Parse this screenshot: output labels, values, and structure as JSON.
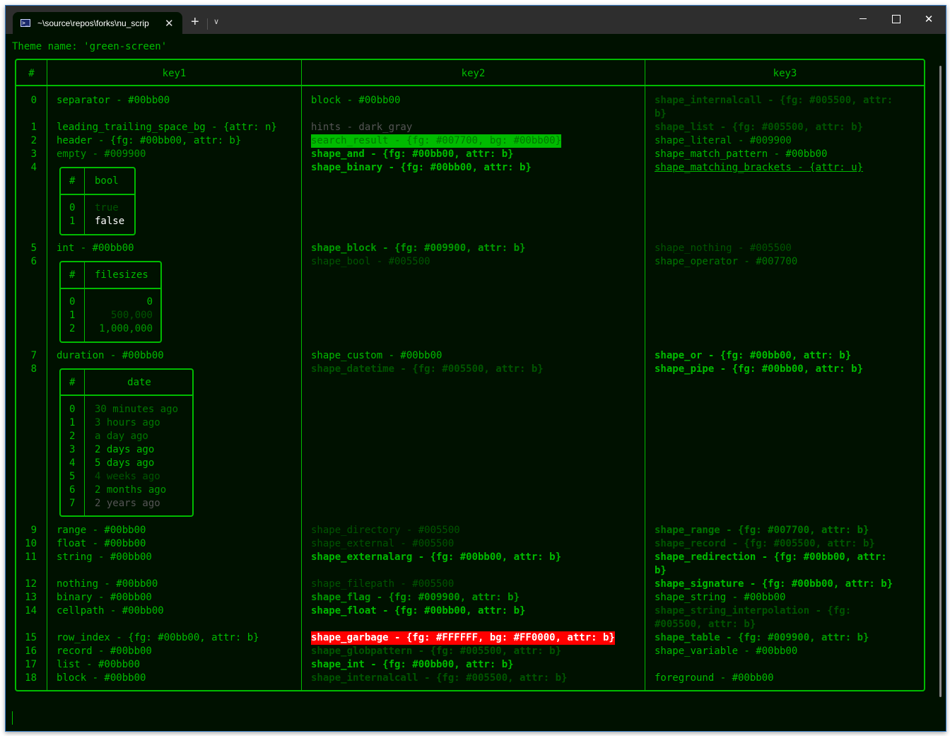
{
  "window": {
    "tab_title": "~\\source\\repos\\forks\\nu_scrip",
    "tab_icon": "powershell-icon",
    "tab_close": "✕",
    "new_tab": "+",
    "dropdown": "⌄",
    "minimize": "minimize",
    "maximize": "maximize",
    "close": "✕"
  },
  "terminal": {
    "theme_line": "Theme name: 'green-screen'",
    "table": {
      "headers": [
        "#",
        "key1",
        "key2",
        "key3"
      ],
      "index": [
        "0",
        "1",
        "2",
        "3",
        "4",
        "5",
        "6",
        "7",
        "8",
        "9",
        "10",
        "11",
        "12",
        "13",
        "14",
        "15",
        "16",
        "17",
        "18"
      ],
      "key1": {
        "separator": "separator - #00bb00",
        "leading_trailing_space_bg": "leading_trailing_space_bg - {attr: n}",
        "header": "header - {fg: #00bb00, attr: b}",
        "empty": "empty - #009900",
        "bool_table": {
          "headers": [
            "#",
            "bool"
          ],
          "rows": [
            {
              "index": "0",
              "value": "true"
            },
            {
              "index": "1",
              "value": "false"
            }
          ]
        },
        "int": "int - #00bb00",
        "filesizes_table": {
          "headers": [
            "#",
            "filesizes"
          ],
          "rows": [
            {
              "index": "0",
              "value": "0"
            },
            {
              "index": "1",
              "value": "500,000"
            },
            {
              "index": "2",
              "value": "1,000,000"
            }
          ]
        },
        "duration": "duration - #00bb00",
        "date_table": {
          "headers": [
            "#",
            "date"
          ],
          "rows": [
            {
              "index": "0",
              "value": "30 minutes ago"
            },
            {
              "index": "1",
              "value": "3 hours ago"
            },
            {
              "index": "2",
              "value": "a day ago"
            },
            {
              "index": "3",
              "value": "2 days ago"
            },
            {
              "index": "4",
              "value": "5 days ago"
            },
            {
              "index": "5",
              "value": "4 weeks ago"
            },
            {
              "index": "6",
              "value": "2 months ago"
            },
            {
              "index": "7",
              "value": "2 years ago"
            }
          ]
        },
        "range": "range - #00bb00",
        "float": "float - #00bb00",
        "string": "string - #00bb00",
        "nothing": "nothing - #00bb00",
        "binary": "binary - #00bb00",
        "cellpath": "cellpath - #00bb00",
        "row_index": "row_index - {fg: #00bb00, attr: b}",
        "record": "record - #00bb00",
        "list": "list - #00bb00",
        "block": "block - #00bb00"
      },
      "key2": {
        "block": "block - #00bb00",
        "hints": "hints - dark_gray",
        "search_result": "search_result - {fg: #007700, bg: #00bb00}",
        "shape_and": "shape_and - {fg: #00bb00, attr: b}",
        "shape_binary": "shape_binary - {fg: #00bb00, attr: b}",
        "shape_block": "shape_block - {fg: #009900, attr: b}",
        "shape_bool": "shape_bool - #005500",
        "shape_custom": "shape_custom - #00bb00",
        "shape_datetime": "shape_datetime - {fg: #005500, attr: b}",
        "shape_directory": "shape_directory - #005500",
        "shape_external": "shape_external - #005500",
        "shape_externalarg": "shape_externalarg - {fg: #00bb00, attr: b}",
        "shape_filepath": "shape_filepath - #005500",
        "shape_flag": "shape_flag - {fg: #009900, attr: b}",
        "shape_float": "shape_float - {fg: #00bb00, attr: b}",
        "shape_garbage": "shape_garbage - {fg: #FFFFFF, bg: #FF0000, attr: b}",
        "shape_globpattern": "shape_globpattern - {fg: #005500, attr: b}",
        "shape_int": "shape_int - {fg: #00bb00, attr: b}",
        "shape_internalcall": "shape_internalcall - {fg: #005500, attr: b}"
      },
      "key3": {
        "shape_internalcall_1": "shape_internalcall - {fg: #005500, attr:",
        "shape_internalcall_2": "b}",
        "shape_list": "shape_list - {fg: #005500, attr: b}",
        "shape_literal": "shape_literal - #009900",
        "shape_match_pattern": "shape_match_pattern - #00bb00",
        "shape_matching_brackets": "shape_matching_brackets - {attr: u}",
        "shape_nothing": "shape_nothing - #005500",
        "shape_operator": "shape_operator - #007700",
        "shape_or": "shape_or - {fg: #00bb00, attr: b}",
        "shape_pipe": "shape_pipe - {fg: #00bb00, attr: b}",
        "shape_range": "shape_range - {fg: #007700, attr: b}",
        "shape_record": "shape_record - {fg: #005500, attr: b}",
        "shape_redirection_1": "shape_redirection - {fg: #00bb00, attr:",
        "shape_redirection_2": "b}",
        "shape_signature": "shape_signature - {fg: #00bb00, attr: b}",
        "shape_string": "shape_string - #00bb00",
        "shape_string_interpolation_1": "shape_string_interpolation - {fg:",
        "shape_string_interpolation_2": "#005500, attr: b}",
        "shape_table": "shape_table - {fg: #009900, attr: b}",
        "shape_variable": "shape_variable - #00bb00",
        "foreground": "foreground - #00bb00"
      }
    }
  },
  "colors": {
    "background": "#001100",
    "foreground": "#00bb00",
    "dim": "#005500",
    "mid": "#007700",
    "soft": "#009900",
    "hints": "#555555",
    "garbage_bg": "#FF0000",
    "titlebar": "#2e2e2e"
  }
}
